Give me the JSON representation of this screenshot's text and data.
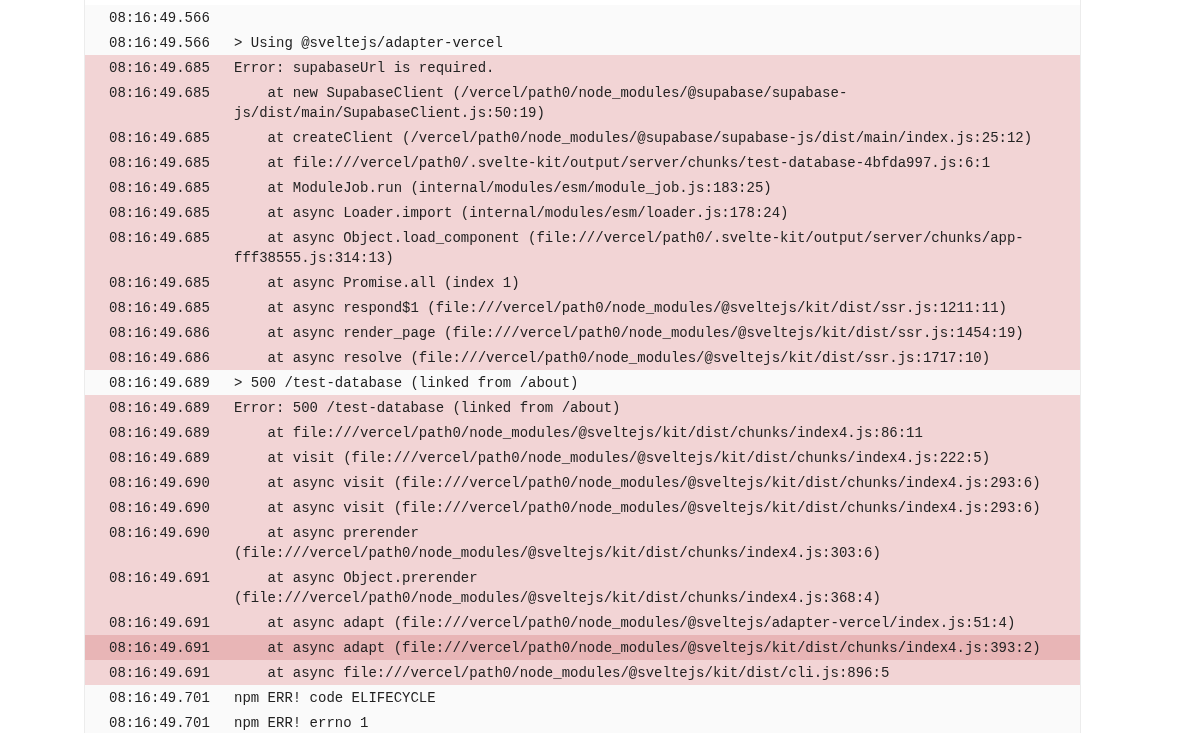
{
  "log_rows": [
    {
      "time": "08:16:49.566",
      "message": "",
      "kind": "info"
    },
    {
      "time": "08:16:49.566",
      "message": "> Using @sveltejs/adapter-vercel",
      "kind": "info"
    },
    {
      "time": "08:16:49.685",
      "message": "Error: supabaseUrl is required.",
      "kind": "error"
    },
    {
      "time": "08:16:49.685",
      "message": "    at new SupabaseClient (/vercel/path0/node_modules/@supabase/supabase-js/dist/main/SupabaseClient.js:50:19)",
      "kind": "error"
    },
    {
      "time": "08:16:49.685",
      "message": "    at createClient (/vercel/path0/node_modules/@supabase/supabase-js/dist/main/index.js:25:12)",
      "kind": "error"
    },
    {
      "time": "08:16:49.685",
      "message": "    at file:///vercel/path0/.svelte-kit/output/server/chunks/test-database-4bfda997.js:6:1",
      "kind": "error"
    },
    {
      "time": "08:16:49.685",
      "message": "    at ModuleJob.run (internal/modules/esm/module_job.js:183:25)",
      "kind": "error"
    },
    {
      "time": "08:16:49.685",
      "message": "    at async Loader.import (internal/modules/esm/loader.js:178:24)",
      "kind": "error"
    },
    {
      "time": "08:16:49.685",
      "message": "    at async Object.load_component (file:///vercel/path0/.svelte-kit/output/server/chunks/app-fff38555.js:314:13)",
      "kind": "error"
    },
    {
      "time": "08:16:49.685",
      "message": "    at async Promise.all (index 1)",
      "kind": "error"
    },
    {
      "time": "08:16:49.685",
      "message": "    at async respond$1 (file:///vercel/path0/node_modules/@sveltejs/kit/dist/ssr.js:1211:11)",
      "kind": "error"
    },
    {
      "time": "08:16:49.686",
      "message": "    at async render_page (file:///vercel/path0/node_modules/@sveltejs/kit/dist/ssr.js:1454:19)",
      "kind": "error"
    },
    {
      "time": "08:16:49.686",
      "message": "    at async resolve (file:///vercel/path0/node_modules/@sveltejs/kit/dist/ssr.js:1717:10)",
      "kind": "error"
    },
    {
      "time": "08:16:49.689",
      "message": "> 500 /test-database (linked from /about)",
      "kind": "info"
    },
    {
      "time": "08:16:49.689",
      "message": "Error: 500 /test-database (linked from /about)",
      "kind": "error"
    },
    {
      "time": "08:16:49.689",
      "message": "    at file:///vercel/path0/node_modules/@sveltejs/kit/dist/chunks/index4.js:86:11",
      "kind": "error"
    },
    {
      "time": "08:16:49.689",
      "message": "    at visit (file:///vercel/path0/node_modules/@sveltejs/kit/dist/chunks/index4.js:222:5)",
      "kind": "error"
    },
    {
      "time": "08:16:49.690",
      "message": "    at async visit (file:///vercel/path0/node_modules/@sveltejs/kit/dist/chunks/index4.js:293:6)",
      "kind": "error"
    },
    {
      "time": "08:16:49.690",
      "message": "    at async visit (file:///vercel/path0/node_modules/@sveltejs/kit/dist/chunks/index4.js:293:6)",
      "kind": "error"
    },
    {
      "time": "08:16:49.690",
      "message": "    at async prerender (file:///vercel/path0/node_modules/@sveltejs/kit/dist/chunks/index4.js:303:6)",
      "kind": "error"
    },
    {
      "time": "08:16:49.691",
      "message": "    at async Object.prerender (file:///vercel/path0/node_modules/@sveltejs/kit/dist/chunks/index4.js:368:4)",
      "kind": "error"
    },
    {
      "time": "08:16:49.691",
      "message": "    at async adapt (file:///vercel/path0/node_modules/@sveltejs/adapter-vercel/index.js:51:4)",
      "kind": "error"
    },
    {
      "time": "08:16:49.691",
      "message": "    at async adapt (file:///vercel/path0/node_modules/@sveltejs/kit/dist/chunks/index4.js:393:2)",
      "kind": "highlight"
    },
    {
      "time": "08:16:49.691",
      "message": "    at async file:///vercel/path0/node_modules/@sveltejs/kit/dist/cli.js:896:5",
      "kind": "error"
    },
    {
      "time": "08:16:49.701",
      "message": "npm ERR! code ELIFECYCLE",
      "kind": "info"
    },
    {
      "time": "08:16:49.701",
      "message": "npm ERR! errno 1",
      "kind": "info"
    }
  ]
}
